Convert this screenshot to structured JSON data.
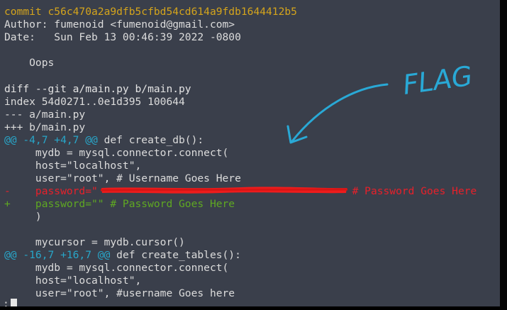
{
  "commit_line": "commit c56c470a2a9dfb5cfbd54cd614a9fdb1644412b5",
  "author_line": "Author: fumenoid <fumenoid@gmail.com>",
  "date_line": "Date:   Sun Feb 13 00:46:39 2022 -0800",
  "message": "    Oops",
  "diff_header": "diff --git a/main.py b/main.py",
  "index_line": "index 54d0271..0e1d395 100644",
  "old_file": "--- a/main.py",
  "new_file": "+++ b/main.py",
  "hunk1": {
    "marker": "@@ -4,7 +4,7 @@",
    "context": " def create_db():",
    "lines": {
      "l1": "     mydb = mysql.connector.connect(",
      "l2": "     host=\"localhost\",",
      "l3": "     user=\"root\", # Username Goes Here",
      "removed_prefix": "-    password=\"",
      "removed_suffix": " # Password Goes Here",
      "added": "+    password=\"\" # Password Goes Here",
      "l6": "     )",
      "l7": "",
      "l8": "     mycursor = mydb.cursor()"
    }
  },
  "hunk2": {
    "marker": "@@ -16,7 +16,7 @@",
    "context": " def create_tables():",
    "lines": {
      "l1": "     mydb = mysql.connector.connect(",
      "l2": "     host=\"localhost\",",
      "l3": "     user=\"root\", #username Goes here"
    }
  },
  "pager_prompt": ":",
  "annotation_text": "FLAG",
  "colors": {
    "background": "#3a3f4b",
    "commit_hash": "#d4a41c",
    "removed": "#e8202a",
    "added": "#5fa822",
    "hunk_marker": "#28a6c9",
    "annotation": "#29a9d6",
    "redaction": "#ee1c1c"
  }
}
